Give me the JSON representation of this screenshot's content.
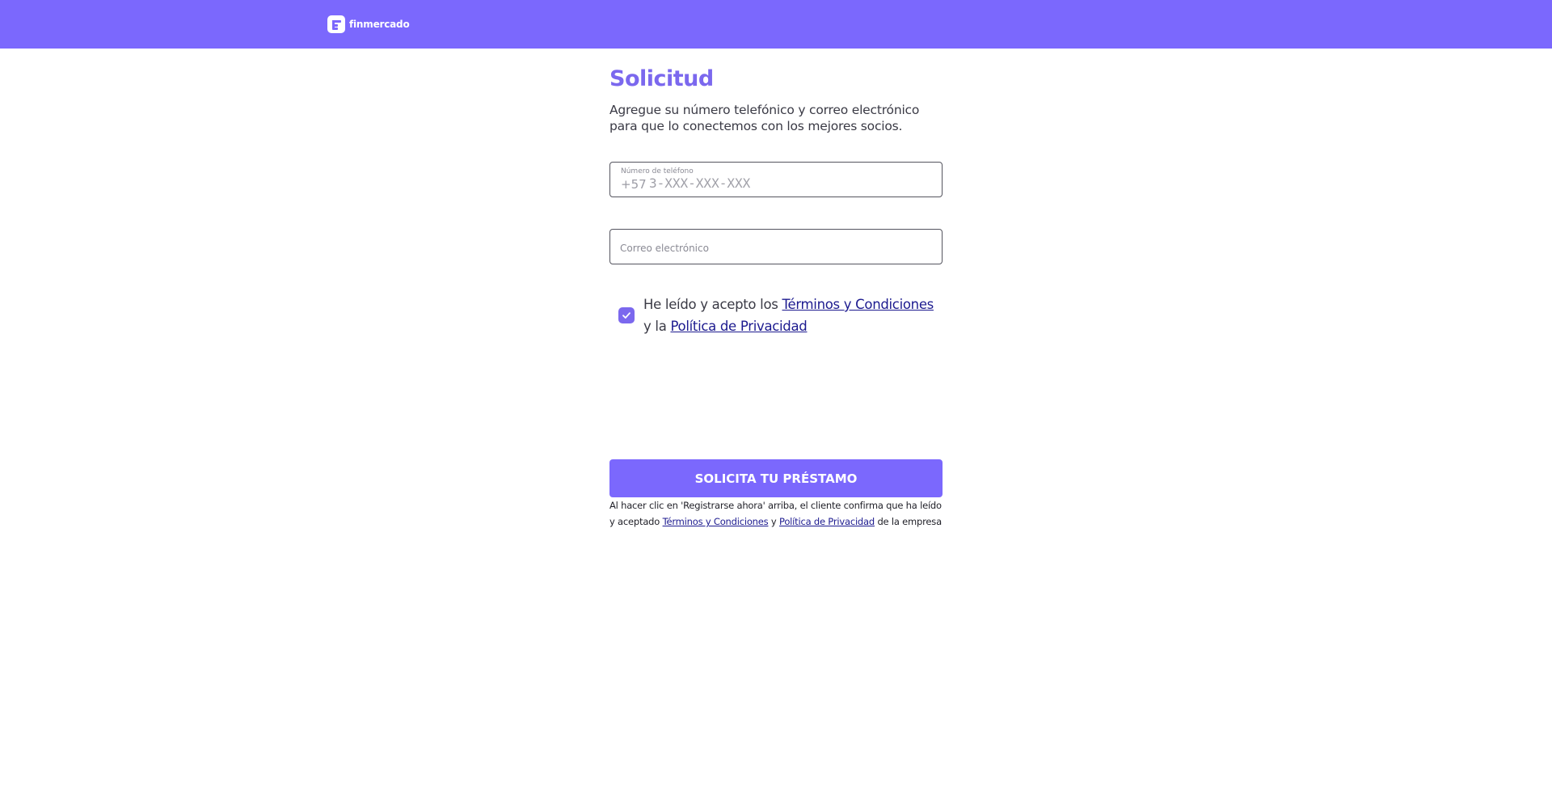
{
  "header": {
    "brand": "finmercado",
    "color": "#7b68fd"
  },
  "form": {
    "title": "Solicitud",
    "subtitle": "Agregue su número telefónico y correo electrónico para que lo conectemos con los mejores socios.",
    "phone": {
      "label": "Número de teléfono",
      "prefix": "+57",
      "placeholder": "3-XXX-XXX-XXX",
      "value": ""
    },
    "email": {
      "placeholder": "Correo electrónico",
      "value": ""
    },
    "consent": {
      "checked": true,
      "text_before": "He leído y acepto los",
      "terms_link": "Términos y Condiciones",
      "text_middle": "y la",
      "privacy_link": "Política de Privacidad"
    },
    "submit_label": "SOLICITA TU PRÉSTAMO",
    "legal": {
      "text_before": "Al hacer clic en 'Registrarse ahora' arriba, el cliente confirma que ha leído y aceptado",
      "terms_link": "Términos y Condiciones",
      "text_middle": "y",
      "privacy_link": "Política de Privacidad",
      "text_after": "de la empresa"
    }
  },
  "colors": {
    "accent": "#7b68ee",
    "link": "#1c1a8f"
  }
}
